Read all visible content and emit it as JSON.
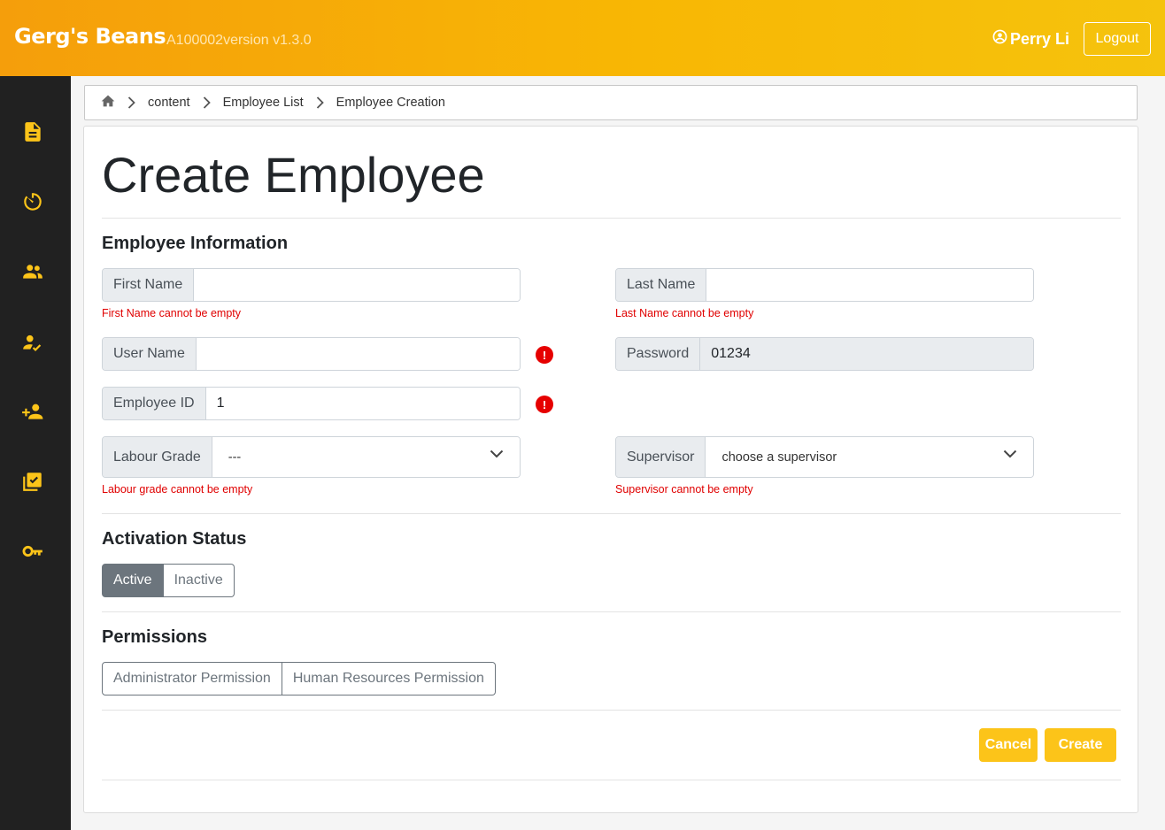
{
  "header": {
    "brand": "Gerg's Beans",
    "version": "A100002version v1.3.0",
    "user_name": "Perry Li",
    "logout_label": "Logout"
  },
  "sidebar": {
    "items": [
      {
        "icon": "document-icon"
      },
      {
        "icon": "timer-icon"
      },
      {
        "icon": "group-icon"
      },
      {
        "icon": "person-check-icon"
      },
      {
        "icon": "person-add-icon"
      },
      {
        "icon": "checkbox-list-icon"
      },
      {
        "icon": "key-icon"
      }
    ]
  },
  "breadcrumb": {
    "home_icon": "home-icon",
    "items": [
      "content",
      "Employee List",
      "Employee Creation"
    ]
  },
  "page": {
    "title": "Create Employee"
  },
  "employee_info": {
    "section_title": "Employee Information",
    "first_name": {
      "label": "First Name",
      "value": "",
      "error": "First Name cannot be empty"
    },
    "last_name": {
      "label": "Last Name",
      "value": "",
      "error": "Last Name cannot be empty"
    },
    "user_name": {
      "label": "User Name",
      "value": ""
    },
    "password": {
      "label": "Password",
      "value": "01234"
    },
    "employee_id": {
      "label": "Employee ID",
      "value": "1"
    },
    "labour_grade": {
      "label": "Labour Grade",
      "selected": "---",
      "error": "Labour grade cannot be empty"
    },
    "supervisor": {
      "label": "Supervisor",
      "selected": "choose a supervisor",
      "error": "Supervisor cannot be empty"
    },
    "alert_glyph": "!"
  },
  "activation": {
    "section_title": "Activation Status",
    "options": [
      "Active",
      "Inactive"
    ],
    "selected": "Active"
  },
  "permissions": {
    "section_title": "Permissions",
    "options": [
      "Administrator Permission",
      "Human Resources Permission"
    ]
  },
  "actions": {
    "cancel_label": "Cancel",
    "create_label": "Create"
  },
  "colors": {
    "header_start": "#f59e0b",
    "header_end": "#f5c30d",
    "sidebar_bg": "#212121",
    "icon_accent": "#fcc419",
    "error": "#e00000",
    "button": "#fcc419"
  }
}
